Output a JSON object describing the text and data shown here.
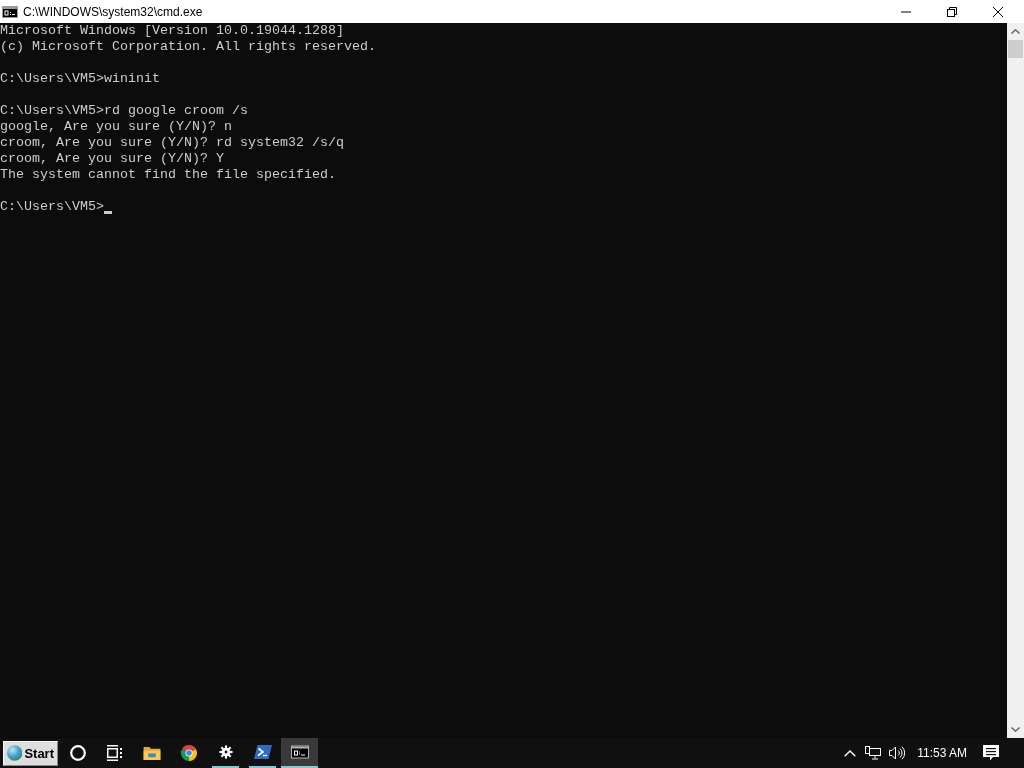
{
  "window": {
    "title": "C:\\WINDOWS\\system32\\cmd.exe"
  },
  "console": {
    "blocks": [
      {
        "lines": [
          "Microsoft Windows [Version 10.0.19044.1288]",
          "(c) Microsoft Corporation. All rights reserved."
        ]
      },
      {
        "lines": [
          "C:\\Users\\VM5>wininit"
        ]
      },
      {
        "lines": [
          "C:\\Users\\VM5>rd google croom /s",
          "google, Are you sure (Y/N)? n",
          "croom, Are you sure (Y/N)? rd system32 /s/q",
          "croom, Are you sure (Y/N)? Y",
          "The system cannot find the file specified."
        ]
      }
    ],
    "prompt": "C:\\Users\\VM5>",
    "cursor": true
  },
  "taskbar": {
    "start_button": "Start",
    "buttons": [
      {
        "kind": "search",
        "running": false,
        "selected": false
      },
      {
        "kind": "task-view",
        "running": false,
        "selected": false
      },
      {
        "kind": "folder",
        "running": false,
        "selected": false
      },
      {
        "kind": "browser",
        "running": false,
        "selected": false
      },
      {
        "kind": "settings",
        "running": true,
        "selected": false
      },
      {
        "kind": "powershell",
        "running": true,
        "selected": false
      },
      {
        "kind": "console",
        "running": true,
        "selected": true
      }
    ],
    "clock": "11:53 AM"
  }
}
